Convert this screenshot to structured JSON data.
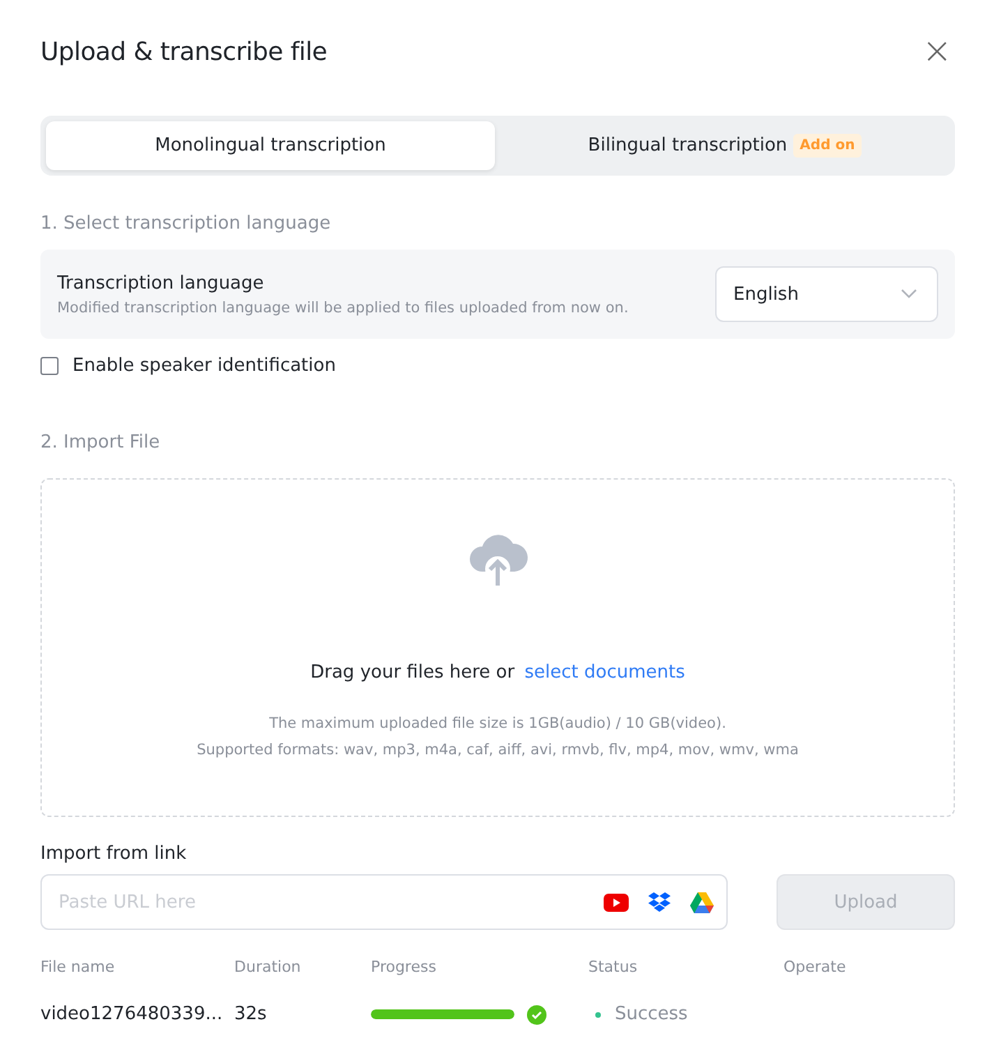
{
  "dialog": {
    "title": "Upload & transcribe file",
    "close": "×"
  },
  "tabs": [
    {
      "label": "Monolingual transcription",
      "selected": true
    },
    {
      "label": "Bilingual transcription",
      "selected": false,
      "badge": "Add on"
    }
  ],
  "language_section": {
    "heading": "1. Select transcription language",
    "label": "Transcription language",
    "hint": "Modified transcription language will be applied to files uploaded from now on.",
    "value": "English"
  },
  "speaker_identification": {
    "label": "Enable speaker identification",
    "checked": false
  },
  "import_section": {
    "heading": "2. Import File",
    "drag_text": "Drag your files here or ",
    "link": "select documents",
    "limits": "The maximum uploaded file size is 1GB(audio) / 10 GB(video).",
    "formats": "Supported formats: wav, mp3, m4a, caf, aiff, avi, rmvb, flv, mp4, mov, wmv, wma"
  },
  "link_import": {
    "label": "Import from link",
    "placeholder": "Paste URL here",
    "button": "Upload",
    "disabled": true
  },
  "table": {
    "columns": [
      "File name",
      "Duration",
      "Progress",
      "Status",
      "Operate"
    ],
    "rows": [
      {
        "file_name": "video1276480339...",
        "duration": "32s",
        "level": 1,
        "done": true,
        "status": "Success",
        "color": "#34c38f"
      }
    ]
  }
}
